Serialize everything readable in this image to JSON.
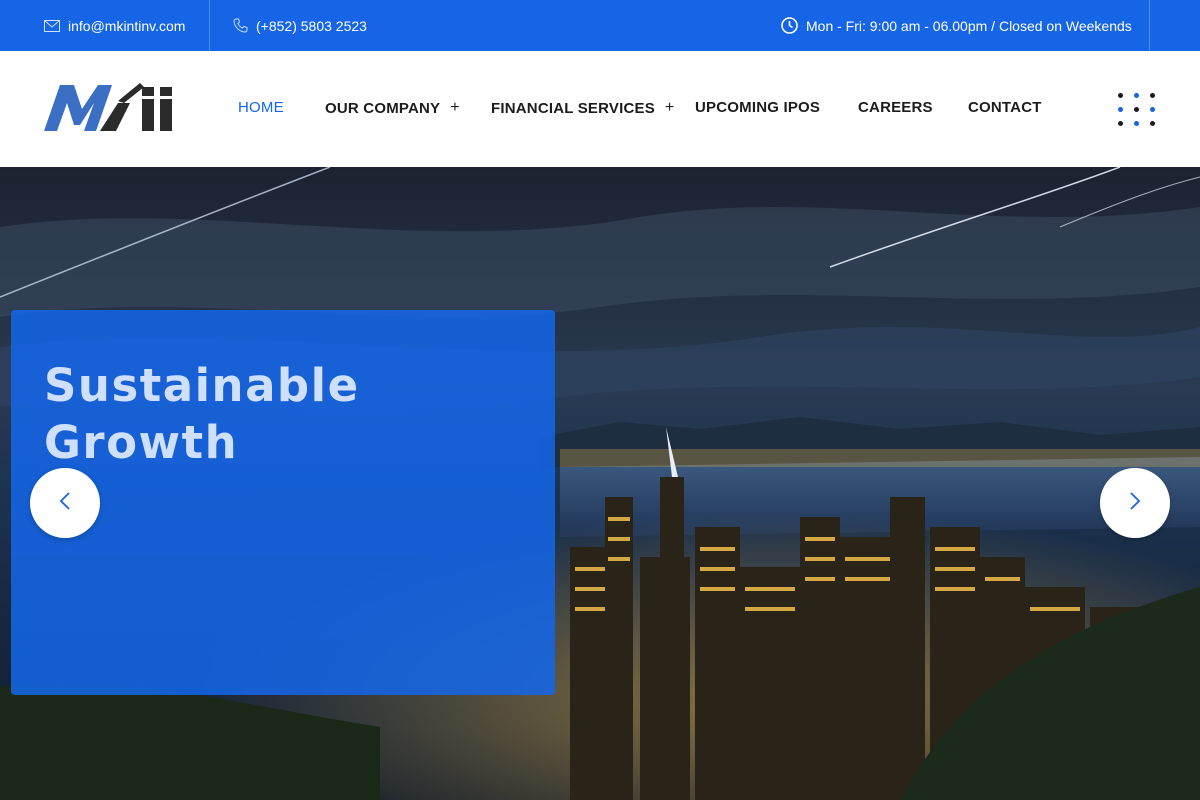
{
  "topbar": {
    "email": "info@mkintinv.com",
    "phone": "(+852) 5803 2523",
    "hours": "Mon - Fri: 9:00 am - 06.00pm / Closed on Weekends",
    "icons": [
      "envelope-icon",
      "phone-icon",
      "clock-icon"
    ]
  },
  "nav": {
    "items": [
      {
        "label": "HOME",
        "active": true,
        "has_submenu": false
      },
      {
        "label": "OUR COMPANY",
        "active": false,
        "has_submenu": true
      },
      {
        "label": "FINANCIAL SERVICES",
        "active": false,
        "has_submenu": true
      },
      {
        "label": "UPCOMING IPOS",
        "active": false,
        "has_submenu": false
      },
      {
        "label": "CAREERS",
        "active": false,
        "has_submenu": false
      },
      {
        "label": "CONTACT",
        "active": false,
        "has_submenu": false
      }
    ],
    "submenu_symbol": "+"
  },
  "hero": {
    "headline": "Sustainable Growth",
    "prev_icon": "chevron-left-icon",
    "next_icon": "chevron-right-icon"
  },
  "colors": {
    "brand": "#1565e6",
    "text_dark": "#1c1c1c",
    "headline": "#cfe0ff"
  }
}
